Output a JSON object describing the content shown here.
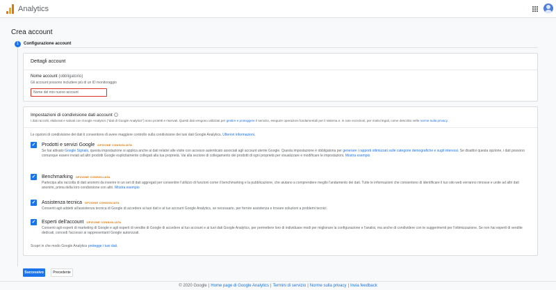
{
  "header": {
    "app_name": "Analytics",
    "logo_colors": [
      "#e37400",
      "#f9ab00"
    ],
    "apps_icon": "grid-apps-icon",
    "avatar_icon": "account-avatar-icon"
  },
  "page": {
    "title": "Crea account",
    "step_number": "1",
    "step_title": "Configurazione account"
  },
  "account_details": {
    "heading": "Dettagli account",
    "name_label": "Nome account",
    "name_optional": "(obbligatorio)",
    "name_hint": "Gli account possono includere più di un ID monitoraggio",
    "name_placeholder": "Nome del mio nuovo account",
    "name_value": ""
  },
  "sharing": {
    "heading": "Impostazioni di condivisione dati account",
    "intro_pre": "I dati raccolti, elaborati e salvati con Google Analytics (\"dati di Google Analytics\") sono protetti e riservati. Questi dati vengono utilizzati per",
    "intro_link1": "gestire e proteggere",
    "intro_mid": "il servizio, eseguire operazioni fondamentali per il sistema e, in rare eccezioni, per motivi legali, come descritto nelle",
    "intro_link2": "norme sulla privacy",
    "intro_end": ".",
    "options_intro_pre": "Le opzioni di condivisione dei dati ti consentono di avere maggiore controllo sulla condivisione dei tuoi dati Google Analytics.",
    "options_intro_link": "Ulteriori informazioni.",
    "recommended_badge": "OPZIONE CONSIGLIATA",
    "options": [
      {
        "title": "Prodotti e servizi Google",
        "checked": true,
        "desc_pre": "Se hai attivato",
        "desc_link1": "Google Signals",
        "desc_mid": ", questa impostazione si applica anche ai dati relativi alle visite con accesso autenticato associati agli account utente Google. Questa impostazione è obbligatoria per",
        "desc_link2": "generare i rapporti ottimizzati sulle categorie demografiche e sugli interessi",
        "desc_end": ". Se disattivi questa opzione, i dati possono comunque essere inviati ad altri prodotti Google esplicitamente collegati alla tua proprietà. Vai alla sezione di collegamento dei prodotti di ogni proprietà per visualizzare e modificare le impostazioni.",
        "desc_link3": "Mostra esempio"
      },
      {
        "title": "Benchmarking",
        "checked": true,
        "desc": "Partecipa alla raccolta di dati anonimi da inserire in un set di dati aggregati per consentire l'utilizzo di funzioni come il benchmarking e la pubblicazione, che aiutano a comprendere meglio l'andamento dei dati. Tutte le informazioni che consentono di identificare il tuo sito web verranno rimosse e unite ad altri dati anonimi, prima della loro condivisione con altri.",
        "desc_link": "Mostra esempio"
      },
      {
        "title": "Assistenza tecnica",
        "checked": true,
        "desc": "Consenti agli addetti all'assistenza tecnica di Google di accedere ai tuoi dati e al tuo account Google Analytics, se necessario, per fornire assistenza e trovare soluzioni a problemi tecnici."
      },
      {
        "title": "Esperti dell'account",
        "checked": true,
        "desc": "Consenti agli esperti di marketing di Google e agli esperti di vendite di Google di accedere al tuo account e ai tuoi dati Google Analytics, per permettere loro di individuare modi per migliorare la configurazione e l'analisi, ma anche di condividere con te suggerimenti per l'ottimizzazione. Se non hai esperti di vendite dedicati, concedi l'accesso ai rappresentanti Google autorizzati."
      }
    ],
    "footer_pre": "Scopri in che modo Google Analytics",
    "footer_link": "protegge i tuoi dati",
    "footer_end": "."
  },
  "actions": {
    "next_label": "Successivo",
    "prev_label": "Precedente"
  },
  "footer": {
    "copyright": "© 2020 Google",
    "links": [
      "Home page di Google Analytics",
      "Termini di servizio",
      "Norme sulla privacy",
      "Invia feedback"
    ]
  },
  "colors": {
    "accent": "#1a73e8",
    "badge": "#e37400",
    "error_border": "#d93025"
  }
}
